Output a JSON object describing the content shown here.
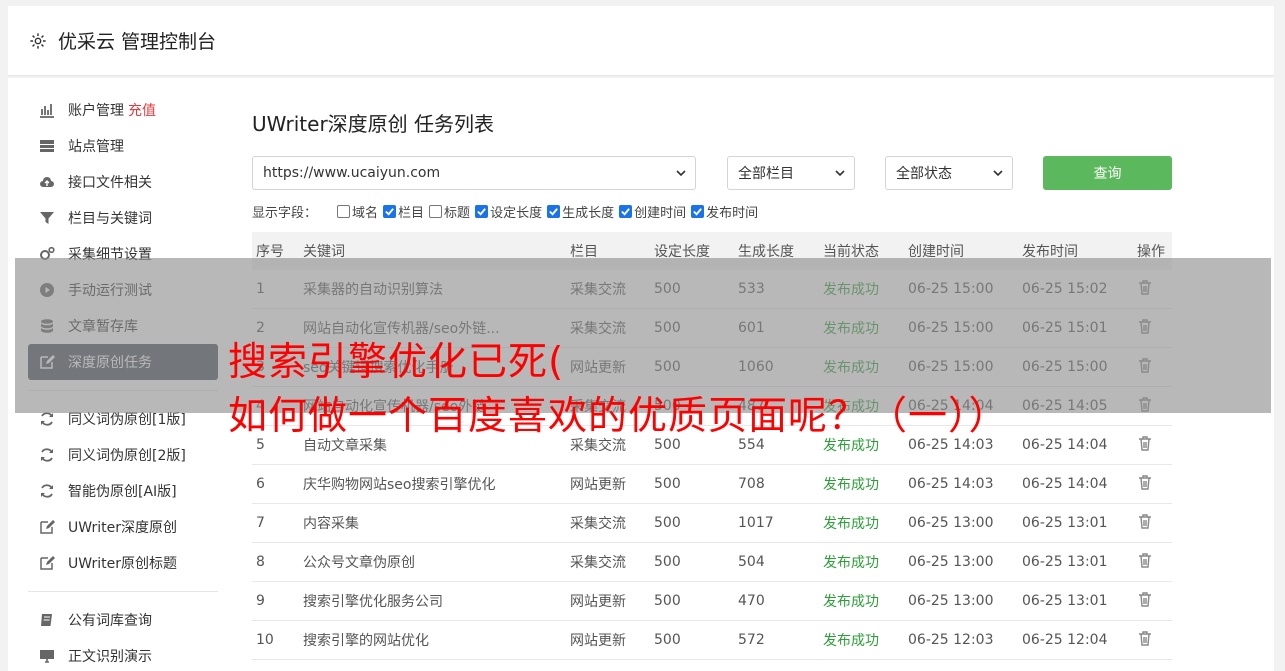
{
  "header": {
    "title": "优采云 管理控制台"
  },
  "sidebar": {
    "items": [
      {
        "label": "账户管理",
        "extra": "充值",
        "icon": "bar-chart-icon"
      },
      {
        "label": "站点管理",
        "icon": "server-icon"
      },
      {
        "label": "接口文件相关",
        "icon": "cloud-upload-icon"
      },
      {
        "label": "栏目与关键词",
        "icon": "filter-icon"
      },
      {
        "label": "采集细节设置",
        "icon": "cogs-icon"
      },
      {
        "label": "手动运行测试",
        "icon": "play-icon"
      },
      {
        "label": "文章暂存库",
        "icon": "database-icon"
      },
      {
        "label": "深度原创任务",
        "icon": "edit-icon",
        "active": true
      }
    ],
    "items2": [
      {
        "label": "同义词伪原创[1版]",
        "icon": "refresh-icon"
      },
      {
        "label": "同义词伪原创[2版]",
        "icon": "refresh-icon"
      },
      {
        "label": "智能伪原创[AI版]",
        "icon": "refresh-icon"
      },
      {
        "label": "UWriter深度原创",
        "icon": "edit-icon"
      },
      {
        "label": "UWriter原创标题",
        "icon": "edit-icon"
      }
    ],
    "items3": [
      {
        "label": "公有词库查询",
        "icon": "book-icon"
      },
      {
        "label": "正文识别演示",
        "icon": "monitor-icon"
      }
    ]
  },
  "main": {
    "title": "UWriter深度原创 任务列表",
    "site_select": "https://www.ucaiyun.com",
    "column_select": "全部栏目",
    "status_select": "全部状态",
    "query_label": "查询",
    "fields_label": "显示字段：",
    "fields": [
      {
        "label": "域名",
        "checked": false
      },
      {
        "label": "栏目",
        "checked": true
      },
      {
        "label": "标题",
        "checked": false
      },
      {
        "label": "设定长度",
        "checked": true
      },
      {
        "label": "生成长度",
        "checked": true
      },
      {
        "label": "创建时间",
        "checked": true
      },
      {
        "label": "发布时间",
        "checked": true
      }
    ],
    "table": {
      "headers": [
        "序号",
        "关键词",
        "栏目",
        "设定长度",
        "生成长度",
        "当前状态",
        "创建时间",
        "发布时间",
        "操作"
      ],
      "rows": [
        [
          "1",
          "采集器的自动识别算法",
          "采集交流",
          "500",
          "533",
          "发布成功",
          "06-25 15:00",
          "06-25 15:02"
        ],
        [
          "2",
          "网站自动化宣传机器/seo外链...",
          "采集交流",
          "500",
          "601",
          "发布成功",
          "06-25 15:00",
          "06-25 15:01"
        ],
        [
          "3",
          "seo关键词搜索优化手册",
          "网站更新",
          "500",
          "1060",
          "发布成功",
          "06-25 15:00",
          "06-25 15:00"
        ],
        [
          "4",
          "网站自动化宣传机器/seo外链",
          "采集交流",
          "500",
          "487",
          "发布成功",
          "06-25 14:04",
          "06-25 14:05"
        ],
        [
          "5",
          "自动文章采集",
          "采集交流",
          "500",
          "554",
          "发布成功",
          "06-25 14:03",
          "06-25 14:04"
        ],
        [
          "6",
          "庆华购物网站seo搜索引擎优化",
          "网站更新",
          "500",
          "708",
          "发布成功",
          "06-25 14:03",
          "06-25 14:04"
        ],
        [
          "7",
          "内容采集",
          "采集交流",
          "500",
          "1017",
          "发布成功",
          "06-25 13:00",
          "06-25 13:01"
        ],
        [
          "8",
          "公众号文章伪原创",
          "采集交流",
          "500",
          "504",
          "发布成功",
          "06-25 13:00",
          "06-25 13:01"
        ],
        [
          "9",
          "搜索引擎优化服务公司",
          "网站更新",
          "500",
          "470",
          "发布成功",
          "06-25 13:00",
          "06-25 13:01"
        ],
        [
          "10",
          "搜索引擎的网站优化",
          "网站更新",
          "500",
          "572",
          "发布成功",
          "06-25 12:03",
          "06-25 12:04"
        ]
      ]
    }
  },
  "overlay": {
    "line1": "搜索引擎优化已死(",
    "line2": "如何做一个百度喜欢的优质页面呢？（一））"
  }
}
